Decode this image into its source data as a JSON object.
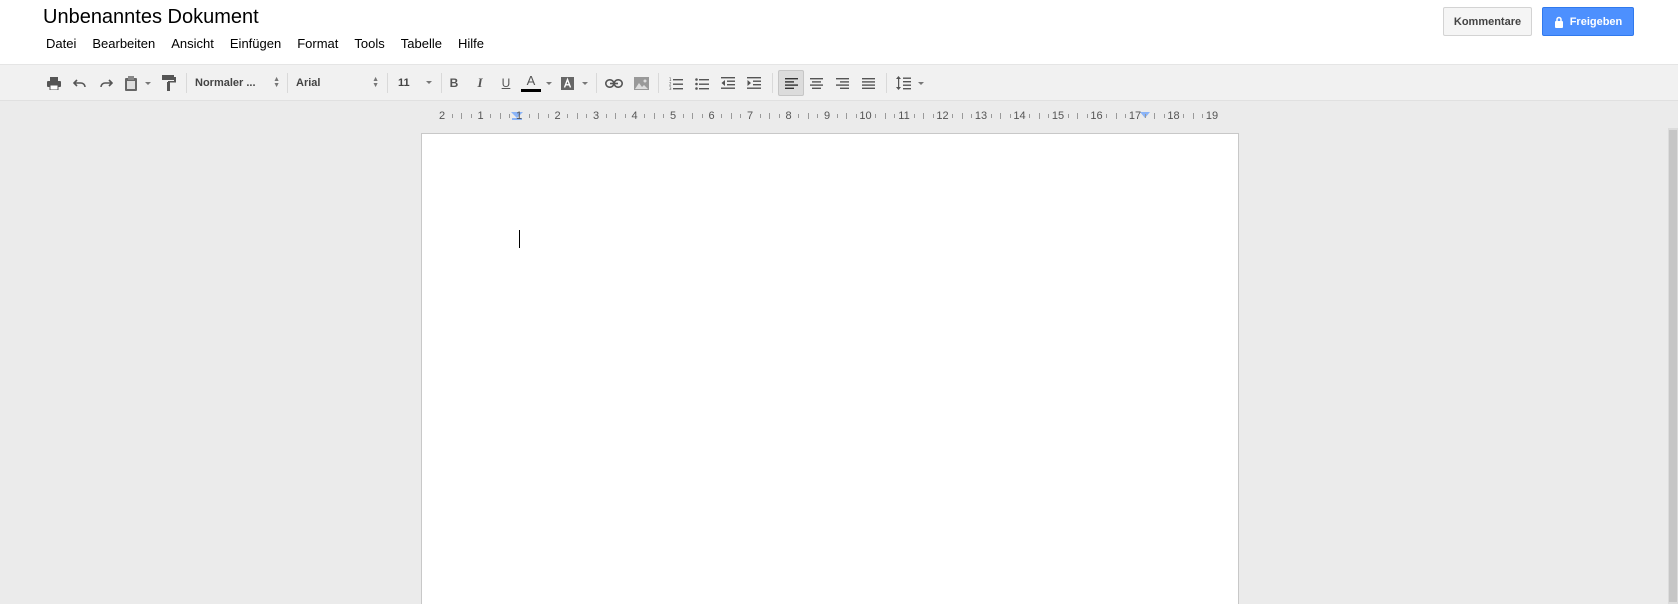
{
  "document": {
    "title": "Unbenanntes Dokument"
  },
  "menu": {
    "items": [
      {
        "label": "Datei"
      },
      {
        "label": "Bearbeiten"
      },
      {
        "label": "Ansicht"
      },
      {
        "label": "Einfügen"
      },
      {
        "label": "Format"
      },
      {
        "label": "Tools"
      },
      {
        "label": "Tabelle"
      },
      {
        "label": "Hilfe"
      }
    ]
  },
  "actions": {
    "comments_label": "Kommentare",
    "share_label": "Freigeben"
  },
  "toolbar": {
    "style_value": "Normaler ...",
    "font_value": "Arial",
    "size_value": "11",
    "bold_label": "B",
    "italic_label": "I",
    "underline_label": "U",
    "text_color_label": "A",
    "text_color": "#000000",
    "accent_color": "#4d90fe"
  },
  "ruler": {
    "numbers": [
      "2",
      "1",
      "1",
      "2",
      "3",
      "4",
      "5",
      "6",
      "7",
      "8",
      "9",
      "10",
      "11",
      "12",
      "13",
      "14",
      "15",
      "16",
      "17",
      "18",
      "19"
    ]
  }
}
